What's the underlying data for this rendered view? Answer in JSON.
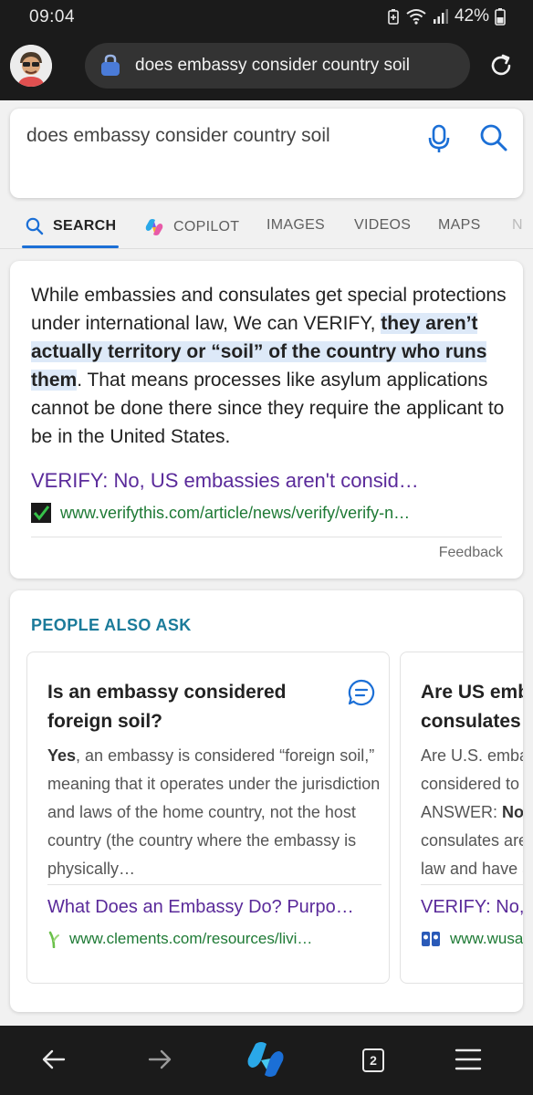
{
  "status_bar": {
    "time": "09:04",
    "battery": "42%"
  },
  "browser": {
    "url_text": "does embassy consider country soil",
    "open_tabs": "2"
  },
  "search": {
    "query": "does embassy consider country soil"
  },
  "tabs": [
    {
      "label": "SEARCH",
      "active": true
    },
    {
      "label": "COPILOT"
    },
    {
      "label": "IMAGES"
    },
    {
      "label": "VIDEOS"
    },
    {
      "label": "MAPS"
    },
    {
      "label": "N"
    }
  ],
  "answer": {
    "text_before": "While embassies and consulates get special protections under international law, We can VERIFY, ",
    "text_highlight": "they aren’t actually territory or “soil” of the country who runs them",
    "text_after": ". That means processes like asylum applications cannot be done there since they require the applicant to be in the United States.",
    "link_title": "VERIFY: No, US embassies aren't consid…",
    "site_url": "www.verifythis.com/article/news/verify/verify-n…",
    "feedback_label": "Feedback"
  },
  "people_also_ask": {
    "title": "PEOPLE ALSO ASK",
    "items": [
      {
        "question": "Is an embassy considered foreign soil?",
        "snippet_bold": "Yes",
        "snippet": ", an embassy is considered “foreign soil,” meaning that it operates under the jurisdiction and laws of the home country, not the host country (the country where the embassy is physically…",
        "link_title": "What Does an Embassy Do? Purpo…",
        "site_url": "www.clements.com/resources/livi…"
      },
      {
        "question": "Are US emba consulates c",
        "snippet_line1": "Are U.S. emba",
        "snippet_line2": "considered to",
        "snippet_line3_prefix": "ANSWER: ",
        "snippet_line3_bold": "No,",
        "snippet_line4": "consulates are",
        "snippet_line5": "law and have a",
        "link_title": "VERIFY: No,",
        "site_url": "www.wusa"
      }
    ]
  },
  "colors": {
    "link_purple": "#5a2a9a",
    "url_green": "#1e7a35",
    "accent_blue": "#1b6fd6",
    "paa_teal": "#1b7b9a"
  }
}
